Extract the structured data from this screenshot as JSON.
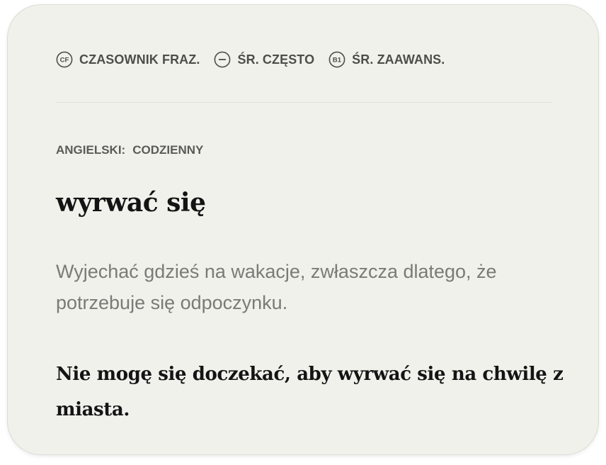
{
  "tags": [
    {
      "icon": "cf-icon",
      "icon_text": "CF",
      "label": "CZASOWNIK FRAZ."
    },
    {
      "icon": "dash-icon",
      "icon_text": "",
      "label": "ŚR. CZĘSTO"
    },
    {
      "icon": "b1-icon",
      "icon_text": "B1",
      "label": "ŚR. ZAAWANS."
    }
  ],
  "context": {
    "language": "ANGIELSKI:",
    "register": "CODZIENNY"
  },
  "entry": {
    "headword": "wyrwać się",
    "definition": "Wyjechać gdzieś na wakacje, zwłaszcza dlatego, że potrzebuje się odpoczynku.",
    "example": "Nie mogę się doczekać, aby wyrwać się na chwilę z miasta."
  },
  "colors": {
    "card_background": "#f1f1ec",
    "text_primary": "#141414",
    "text_muted": "#7a7a76",
    "tag_text": "#4d4d4a"
  }
}
